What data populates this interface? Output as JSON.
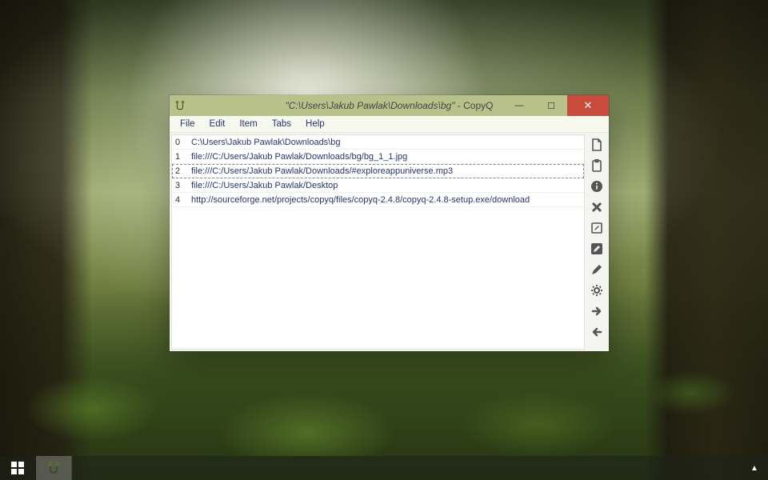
{
  "window": {
    "title_path": "\"C:\\Users\\Jakub Pawlak\\Downloads\\bg\"",
    "title_app": "CopyQ"
  },
  "menu": {
    "items": [
      "File",
      "Edit",
      "Item",
      "Tabs",
      "Help"
    ]
  },
  "clipboard": {
    "selected_index": 2,
    "items": [
      {
        "idx": "0",
        "text": "C:\\Users\\Jakub Pawlak\\Downloads\\bg"
      },
      {
        "idx": "1",
        "text": "file:///C:/Users/Jakub Pawlak/Downloads/bg/bg_1_1.jpg"
      },
      {
        "idx": "2",
        "text": "file:///C:/Users/Jakub Pawlak/Downloads/#exploreappuniverse.mp3"
      },
      {
        "idx": "3",
        "text": "file:///C:/Users/Jakub Pawlak/Desktop"
      },
      {
        "idx": "4",
        "text": "http://sourceforge.net/projects/copyq/files/copyq-2.4.8/copyq-2.4.8-setup.exe/download"
      }
    ]
  },
  "toolbar": {
    "icons": [
      "new-icon",
      "paste-icon",
      "info-icon",
      "delete-icon",
      "edit-note-icon",
      "edit-item-icon",
      "pen-icon",
      "settings-icon",
      "forward-icon",
      "back-icon"
    ]
  },
  "taskbar": {
    "start": "Start",
    "app": "CopyQ",
    "tray": "Show hidden icons"
  }
}
